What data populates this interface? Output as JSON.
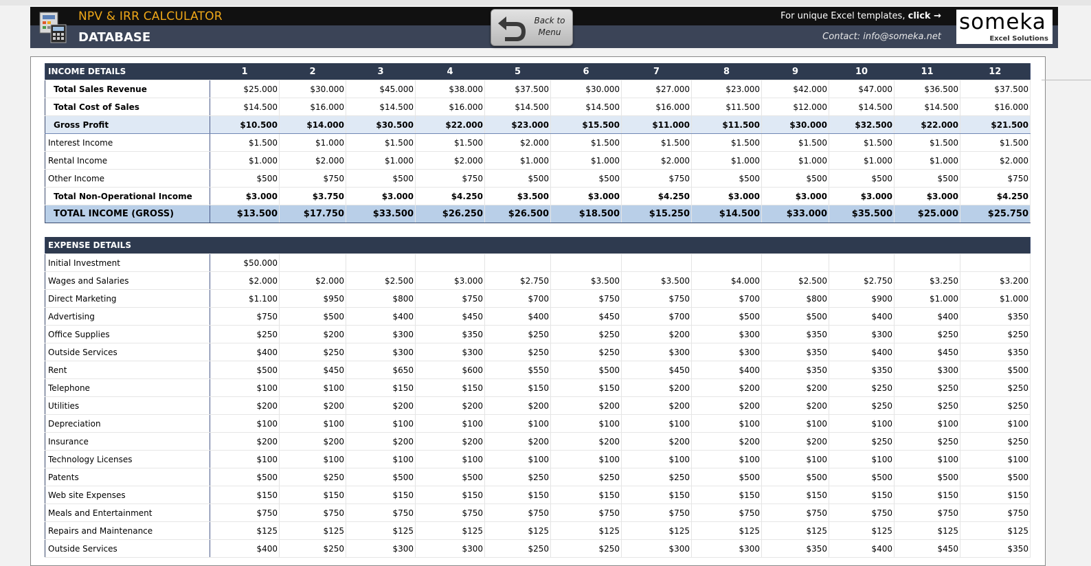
{
  "header": {
    "app_title": "NPV & IRR CALCULATOR",
    "page_title": "DATABASE",
    "back_button": "Back to\nMenu",
    "promo_text": "For unique Excel templates,",
    "promo_link": "click →",
    "contact": "Contact: info@someka.net",
    "logo_name": "someka",
    "logo_sub": "Excel Solutions"
  },
  "income": {
    "header_label": "INCOME DETAILS",
    "periods": [
      "1",
      "2",
      "3",
      "4",
      "5",
      "6",
      "7",
      "8",
      "9",
      "10",
      "11",
      "12"
    ],
    "rows": [
      {
        "label": "Total Sales Revenue",
        "style": "ind",
        "values": [
          "$25.000",
          "$30.000",
          "$45.000",
          "$38.000",
          "$37.500",
          "$30.000",
          "$27.000",
          "$23.000",
          "$42.000",
          "$47.000",
          "$36.500",
          "$37.500"
        ]
      },
      {
        "label": "Total Cost of Sales",
        "style": "ind",
        "values": [
          "$14.500",
          "$16.000",
          "$14.500",
          "$16.000",
          "$14.500",
          "$14.500",
          "$16.000",
          "$11.500",
          "$12.000",
          "$14.500",
          "$14.500",
          "$16.000"
        ]
      },
      {
        "label": "Gross Profit",
        "style": "gross",
        "values": [
          "$10.500",
          "$14.000",
          "$30.500",
          "$22.000",
          "$23.000",
          "$15.500",
          "$11.000",
          "$11.500",
          "$30.000",
          "$32.500",
          "$22.000",
          "$21.500"
        ]
      },
      {
        "label": "Interest Income",
        "style": "plain",
        "values": [
          "$1.500",
          "$1.000",
          "$1.500",
          "$1.500",
          "$2.000",
          "$1.500",
          "$1.500",
          "$1.500",
          "$1.500",
          "$1.500",
          "$1.500",
          "$1.500"
        ]
      },
      {
        "label": "Rental Income",
        "style": "plain",
        "values": [
          "$1.000",
          "$2.000",
          "$1.000",
          "$2.000",
          "$1.000",
          "$1.000",
          "$2.000",
          "$1.000",
          "$1.000",
          "$1.000",
          "$1.000",
          "$2.000"
        ]
      },
      {
        "label": "Other Income",
        "style": "plain",
        "values": [
          "$500",
          "$750",
          "$500",
          "$750",
          "$500",
          "$500",
          "$750",
          "$500",
          "$500",
          "$500",
          "$500",
          "$750"
        ]
      },
      {
        "label": "Total Non-Operational Income",
        "style": "nonop",
        "values": [
          "$3.000",
          "$3.750",
          "$3.000",
          "$4.250",
          "$3.500",
          "$3.000",
          "$4.250",
          "$3.000",
          "$3.000",
          "$3.000",
          "$3.000",
          "$4.250"
        ]
      },
      {
        "label": "TOTAL INCOME (GROSS)",
        "style": "total",
        "values": [
          "$13.500",
          "$17.750",
          "$33.500",
          "$26.250",
          "$26.500",
          "$18.500",
          "$15.250",
          "$14.500",
          "$33.000",
          "$35.500",
          "$25.000",
          "$25.750"
        ]
      }
    ]
  },
  "expense": {
    "header_label": "EXPENSE DETAILS",
    "rows": [
      {
        "label": "Initial Investment",
        "values": [
          "$50.000",
          "",
          "",
          "",
          "",
          "",
          "",
          "",
          "",
          "",
          "",
          ""
        ]
      },
      {
        "label": "Wages and Salaries",
        "values": [
          "$2.000",
          "$2.000",
          "$2.500",
          "$3.000",
          "$2.750",
          "$3.500",
          "$3.500",
          "$4.000",
          "$2.500",
          "$2.750",
          "$3.250",
          "$3.200"
        ]
      },
      {
        "label": "Direct Marketing",
        "values": [
          "$1.100",
          "$950",
          "$800",
          "$750",
          "$700",
          "$750",
          "$750",
          "$700",
          "$800",
          "$900",
          "$1.000",
          "$1.000"
        ]
      },
      {
        "label": "Advertising",
        "values": [
          "$750",
          "$500",
          "$400",
          "$450",
          "$400",
          "$450",
          "$700",
          "$500",
          "$500",
          "$400",
          "$400",
          "$350"
        ]
      },
      {
        "label": "Office Supplies",
        "values": [
          "$250",
          "$200",
          "$300",
          "$350",
          "$250",
          "$250",
          "$200",
          "$300",
          "$350",
          "$300",
          "$250",
          "$250"
        ]
      },
      {
        "label": "Outside Services",
        "values": [
          "$400",
          "$250",
          "$300",
          "$300",
          "$250",
          "$250",
          "$300",
          "$300",
          "$350",
          "$400",
          "$450",
          "$350"
        ]
      },
      {
        "label": "Rent",
        "values": [
          "$500",
          "$450",
          "$650",
          "$600",
          "$550",
          "$500",
          "$450",
          "$400",
          "$350",
          "$350",
          "$300",
          "$500"
        ]
      },
      {
        "label": "Telephone",
        "values": [
          "$100",
          "$100",
          "$150",
          "$150",
          "$150",
          "$150",
          "$200",
          "$200",
          "$200",
          "$250",
          "$250",
          "$250"
        ]
      },
      {
        "label": "Utilities",
        "values": [
          "$200",
          "$200",
          "$200",
          "$200",
          "$200",
          "$200",
          "$200",
          "$200",
          "$200",
          "$250",
          "$250",
          "$250"
        ]
      },
      {
        "label": "Depreciation",
        "values": [
          "$100",
          "$100",
          "$100",
          "$100",
          "$100",
          "$100",
          "$100",
          "$100",
          "$100",
          "$100",
          "$100",
          "$100"
        ]
      },
      {
        "label": "Insurance",
        "values": [
          "$200",
          "$200",
          "$200",
          "$200",
          "$200",
          "$200",
          "$200",
          "$200",
          "$200",
          "$250",
          "$250",
          "$250"
        ]
      },
      {
        "label": "Technology Licenses",
        "values": [
          "$100",
          "$100",
          "$100",
          "$100",
          "$100",
          "$100",
          "$100",
          "$100",
          "$100",
          "$100",
          "$100",
          "$100"
        ]
      },
      {
        "label": "Patents",
        "values": [
          "$500",
          "$250",
          "$500",
          "$500",
          "$250",
          "$250",
          "$250",
          "$500",
          "$500",
          "$500",
          "$500",
          "$500"
        ]
      },
      {
        "label": "Web site Expenses",
        "values": [
          "$150",
          "$150",
          "$150",
          "$150",
          "$150",
          "$150",
          "$150",
          "$150",
          "$150",
          "$150",
          "$150",
          "$150"
        ]
      },
      {
        "label": "Meals and Entertainment",
        "values": [
          "$750",
          "$750",
          "$750",
          "$750",
          "$750",
          "$750",
          "$750",
          "$750",
          "$750",
          "$750",
          "$750",
          "$750"
        ]
      },
      {
        "label": "Repairs and Maintenance",
        "values": [
          "$125",
          "$125",
          "$125",
          "$125",
          "$125",
          "$125",
          "$125",
          "$125",
          "$125",
          "$125",
          "$125",
          "$125"
        ]
      },
      {
        "label": "Outside Services",
        "values": [
          "$400",
          "$250",
          "$300",
          "$300",
          "$250",
          "$250",
          "$300",
          "$300",
          "$350",
          "$400",
          "$450",
          "$350"
        ]
      }
    ]
  }
}
